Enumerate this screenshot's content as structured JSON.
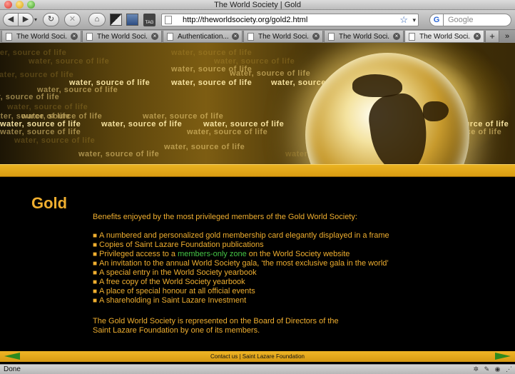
{
  "window": {
    "title": "The World Society | Gold"
  },
  "toolbar": {
    "back": "◀",
    "forward": "▶",
    "dropdown": "▾",
    "reload": "↻",
    "stop": "✕",
    "home": "⌂",
    "tag_label": "TAG",
    "url": "http://theworldsociety.org/gold2.html",
    "bookmark_star": "☆",
    "url_dropdown": "▾",
    "search_engine_glyph": "G",
    "search_placeholder": "Google"
  },
  "tabs": [
    {
      "label": "The World Soci..."
    },
    {
      "label": "The World Soci..."
    },
    {
      "label": "Authentication..."
    },
    {
      "label": "The World Soci..."
    },
    {
      "label": "The World Soci..."
    },
    {
      "label": "The World Soci..."
    }
  ],
  "tab_add": "+",
  "tab_list": "»",
  "tab_close": "×",
  "banner": {
    "text": "water, source of life"
  },
  "page": {
    "title": "Gold",
    "intro": "Benefits enjoyed by the most privileged members of the Gold World Society:",
    "bullet": "■",
    "benefits": [
      "A numbered and personalized gold membership card elegantly displayed in a frame",
      "Copies of Saint Lazare Foundation publications"
    ],
    "privileged_prefix": "Privileged access to a ",
    "members_link": "members-only zone",
    "privileged_suffix": " on the World Society website",
    "benefits_after": [
      "An invitation to the annual World Society gala, ‘the most exclusive gala in the world’",
      "A special entry in the World Society yearbook",
      "A free copy of the World Society yearbook",
      "A place of special honour at all official events",
      "A shareholding in Saint Lazare Investment"
    ],
    "closing_line1": "The Gold World Society is represented on the Board of Directors of the",
    "closing_line2": "Saint Lazare Foundation by one of its members."
  },
  "footer": {
    "contact": "Contact us",
    "separator": " | ",
    "foundation": "Saint Lazare Foundation"
  },
  "status": {
    "text": "Done"
  },
  "colors": {
    "gold_text": "#efae2f",
    "link_green": "#45c445",
    "band_gold": "#e0a518",
    "arrow_green": "#2d8a1e"
  }
}
